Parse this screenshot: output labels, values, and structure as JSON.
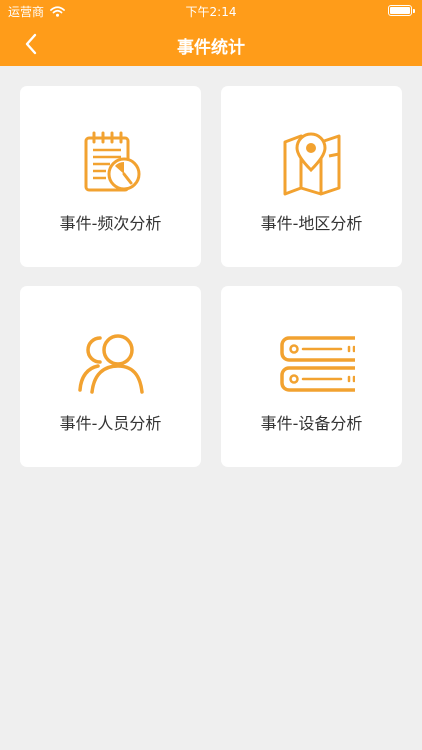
{
  "status_bar": {
    "carrier": "运营商",
    "time": "下午2:14"
  },
  "nav": {
    "title": "事件统计",
    "back_icon": "chevron-left-icon"
  },
  "colors": {
    "accent": "#ff9c19",
    "background": "#efefef",
    "card": "#ffffff",
    "text": "#333333"
  },
  "cards": [
    {
      "label": "事件-频次分析",
      "icon": "calendar-clock-icon"
    },
    {
      "label": "事件-地区分析",
      "icon": "map-pin-icon"
    },
    {
      "label": "事件-人员分析",
      "icon": "users-icon"
    },
    {
      "label": "事件-设备分析",
      "icon": "server-icon"
    }
  ]
}
